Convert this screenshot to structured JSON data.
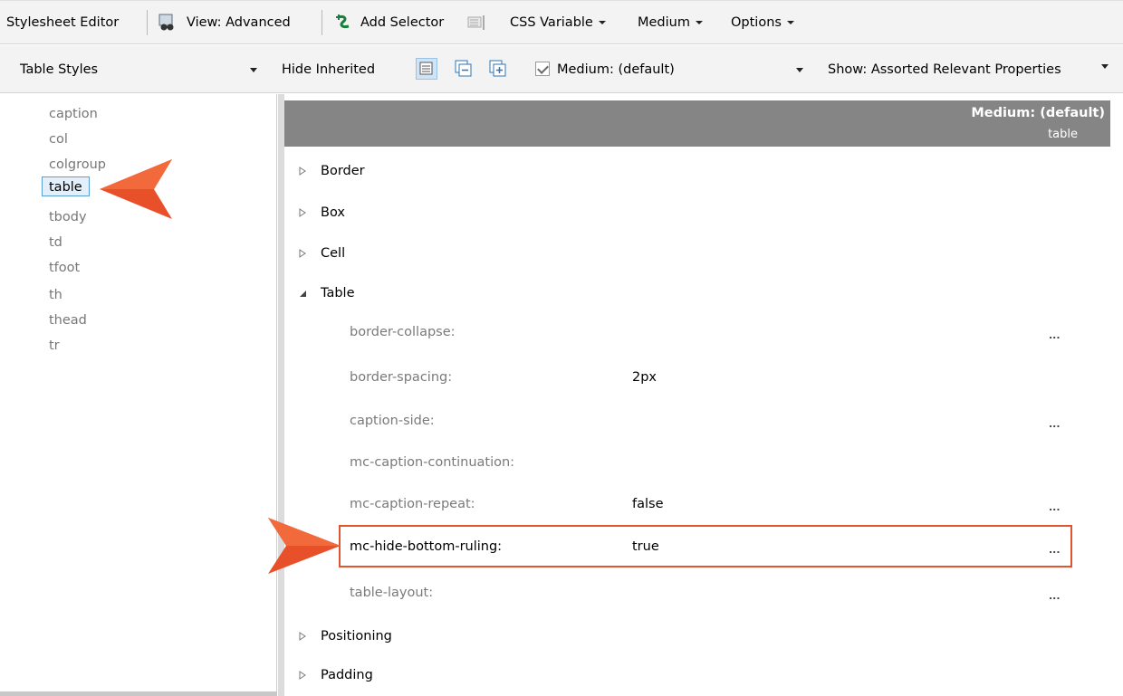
{
  "toolbar1": {
    "title": "Stylesheet Editor",
    "view_label": "View: Advanced",
    "add_selector_label": "Add Selector",
    "css_variable_label": "CSS Variable",
    "medium_label": "Medium",
    "options_label": "Options"
  },
  "toolbar2": {
    "styles_dropdown": "Table Styles",
    "hide_inherited_label": "Hide Inherited",
    "medium_checkbox_label": "Medium: (default)",
    "show_dropdown": "Show: Assorted Relevant Properties"
  },
  "selectors": [
    {
      "label": "caption",
      "selected": false
    },
    {
      "label": "col",
      "selected": false
    },
    {
      "label": "colgroup",
      "selected": false
    },
    {
      "label": "table",
      "selected": true
    },
    {
      "label": "tbody",
      "selected": false
    },
    {
      "label": "td",
      "selected": false
    },
    {
      "label": "tfoot",
      "selected": false
    },
    {
      "label": "th",
      "selected": false
    },
    {
      "label": "thead",
      "selected": false
    },
    {
      "label": "tr",
      "selected": false
    }
  ],
  "properties_header": {
    "medium": "Medium: (default)",
    "selector": "table"
  },
  "groups": {
    "border": "Border",
    "box": "Box",
    "cell": "Cell",
    "table": "Table",
    "positioning": "Positioning",
    "padding": "Padding"
  },
  "table_properties": [
    {
      "name": "border-collapse:",
      "value": "",
      "has_menu": true
    },
    {
      "name": "border-spacing:",
      "value": "2px",
      "has_menu": false
    },
    {
      "name": "caption-side:",
      "value": "",
      "has_menu": true
    },
    {
      "name": "mc-caption-continuation:",
      "value": "",
      "has_menu": false
    },
    {
      "name": "mc-caption-repeat:",
      "value": "false",
      "has_menu": true
    },
    {
      "name": "mc-hide-bottom-ruling:",
      "value": "true",
      "has_menu": true
    },
    {
      "name": "table-layout:",
      "value": "",
      "has_menu": true
    }
  ],
  "menu_dots": "...",
  "colors": {
    "accent": "#e0542f",
    "header_bg": "#858585",
    "selection_border": "#5a9fd6"
  }
}
